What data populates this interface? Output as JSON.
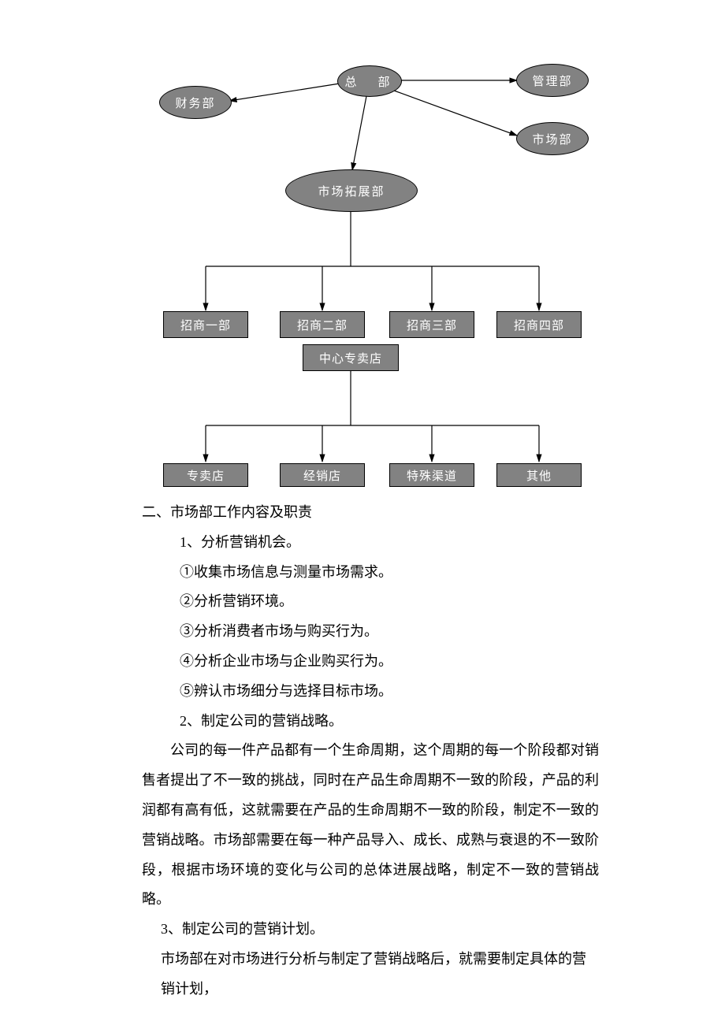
{
  "nodes": {
    "hq": "总　部",
    "finance": "财务部",
    "mgmt": "管理部",
    "market": "市场部",
    "expand": "市场拓展部",
    "zs1": "招商一部",
    "zs2": "招商二部",
    "zs3": "招商三部",
    "zs4": "招商四部",
    "center": "中心专卖店",
    "shop": "专卖店",
    "dealer": "经销店",
    "special": "特殊渠道",
    "other": "其他"
  },
  "text": {
    "heading": "二、市场部工作内容及职责",
    "l1": "1、分析营销机会。",
    "l1_1": "①收集市场信息与测量市场需求。",
    "l1_2": "②分析营销环境。",
    "l1_3": "③分析消费者市场与购买行为。",
    "l1_4": "④分析企业市场与企业购买行为。",
    "l1_5": "⑤辨认市场细分与选择目标市场。",
    "l2": "2、制定公司的营销战略。",
    "para2": "公司的每一件产品都有一个生命周期，这个周期的每一个阶段都对销售者提出了不一致的挑战，同时在产品生命周期不一致的阶段，产品的利润都有高有低，这就需要在产品的生命周期不一致的阶段，制定不一致的营销战略。市场部需要在每一种产品导入、成长、成熟与衰退的不一致阶段，根据市场环境的变化与公司的总体进展战略，制定不一致的营销战略。",
    "l3": "3、制定公司的营销计划。",
    "para3": "市场部在对市场进行分析与制定了营销战略后，就需要制定具体的营销计划，"
  }
}
